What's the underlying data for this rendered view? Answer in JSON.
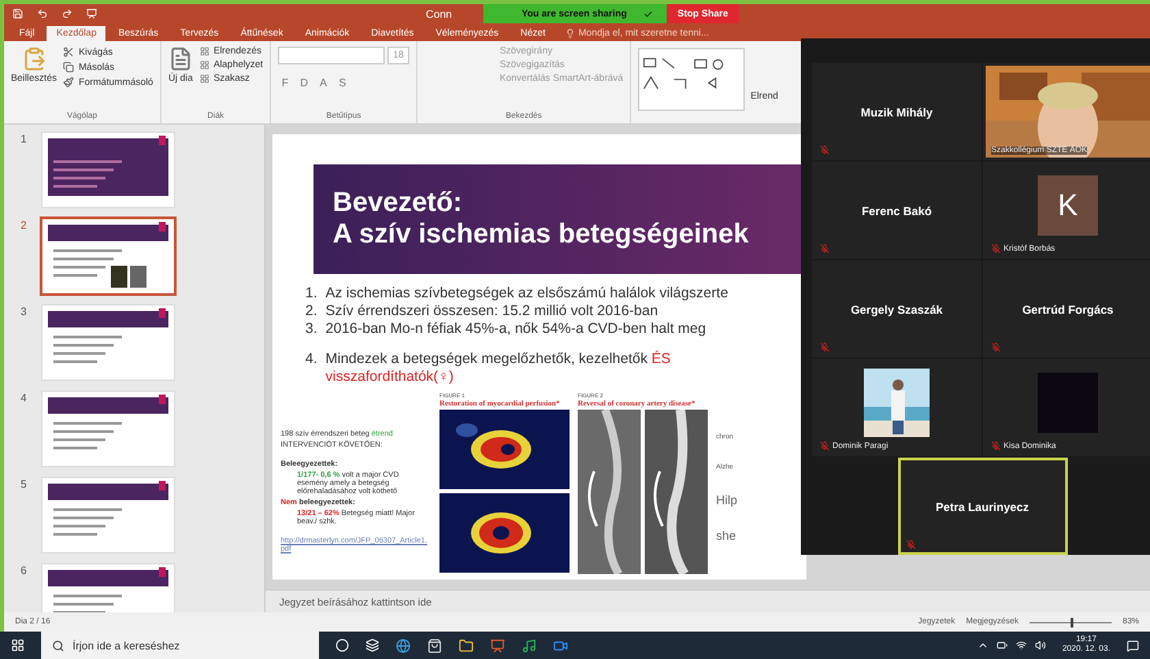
{
  "title_bar": {
    "title": "Conn"
  },
  "share_banner": {
    "status": "You are screen sharing",
    "stop": "Stop Share"
  },
  "tabs": [
    {
      "label": "Fájl",
      "selected": false
    },
    {
      "label": "Kezdőlap",
      "selected": true
    },
    {
      "label": "Beszúrás",
      "selected": false
    },
    {
      "label": "Tervezés",
      "selected": false
    },
    {
      "label": "Áttűnések",
      "selected": false
    },
    {
      "label": "Animációk",
      "selected": false
    },
    {
      "label": "Diavetítés",
      "selected": false
    },
    {
      "label": "Véleményezés",
      "selected": false
    },
    {
      "label": "Nézet",
      "selected": false
    }
  ],
  "tell_me": {
    "placeholder": "Mondja el, mit szeretne tenni..."
  },
  "ribbon": {
    "clipboard": {
      "paste": "Beillesztés",
      "items": [
        "Kivágás",
        "Másolás",
        "Formátummásoló"
      ],
      "group": "Vágólap"
    },
    "slides": {
      "new": "Új dia",
      "items": [
        "Elrendezés",
        "Alaphelyzet",
        "Szakasz"
      ],
      "group": "Diák"
    },
    "font": {
      "size": "18",
      "buttons": [
        "F",
        "D",
        "A",
        "S"
      ],
      "group": "Betűtípus"
    },
    "paragraph": {
      "items": [
        "Szövegirány",
        "Szövegigazítás",
        "Konvertálás SmartArt-ábrává"
      ],
      "group": "Bekezdés"
    },
    "drawing": {
      "label": "Elrend"
    }
  },
  "thumbnails": [
    {
      "number": "1",
      "selected": false
    },
    {
      "number": "2",
      "selected": true
    },
    {
      "number": "3",
      "selected": false
    },
    {
      "number": "4",
      "selected": false
    },
    {
      "number": "5",
      "selected": false
    },
    {
      "number": "6",
      "selected": false
    }
  ],
  "slide": {
    "title": "Bevezető:",
    "subtitle": "A szív ischemias betegségeinek",
    "points": [
      {
        "number": "1.",
        "text": "Az ischemias szívbetegségek az elsőszámú halálok világszerte"
      },
      {
        "number": "2.",
        "text": "Szív érrendszeri összesen: 15.2 millió volt 2016-ban"
      },
      {
        "number": "3.",
        "text": "2016-ban Mo-n féfiak 45%-a, nők 54%-a CVD-ben halt meg"
      },
      {
        "number": "4.",
        "text": "Mindezek a betegségek megelőzhetők, kezelhetők",
        "highlight": "ÉS visszafordíthatók(♀)"
      }
    ],
    "study": {
      "intro": "198 szív érrendszeri beteg",
      "intro_green": "étrend",
      "intro2": "INTERVENCIÓT KÖVETŐEN:",
      "groups": [
        {
          "heading": "Beleegyezettek:",
          "figure": "1/177- 0,6 %",
          "kind": "positive",
          "text": "volt a major CVD esemény amely a betegség előrehaladásához volt köthető"
        },
        {
          "heading": "beleegyezettek:",
          "heading_red": "Nem",
          "figure": "13/21 – 62%",
          "kind": "negative",
          "text": "Betegség miatt! Major beav./ szhk."
        }
      ],
      "link": "http://drmasterlyn.com/JFP_06307_Article1.pdf"
    },
    "figures": [
      {
        "label": "FIGURE 1",
        "caption": "Restoration of myocardial perfusion*",
        "kind": "scan"
      },
      {
        "label": "FIGURE 2",
        "caption": "Reversal of coronary artery disease*",
        "kind": "angio"
      }
    ],
    "side_texts": [
      "chron",
      "Alzhe",
      "Hilp",
      "she"
    ]
  },
  "notes": {
    "placeholder": "Jegyzet beírásához kattintson ide"
  },
  "gallery": [
    {
      "name": "Muzik Mihály",
      "kind": "name",
      "active": false
    },
    {
      "name": "Szakkollégium SZTE ÁOK",
      "kind": "video",
      "active": false
    },
    {
      "name": "Ferenc Bakó",
      "kind": "name",
      "active": false
    },
    {
      "name": "Kristóf Borbás",
      "kind": "avatar",
      "initial": "K",
      "active": false
    },
    {
      "name": "Gergely Szaszák",
      "kind": "name",
      "active": false
    },
    {
      "name": "Gertrúd Forgács",
      "kind": "name",
      "active": false
    },
    {
      "name": "Dominik Paragi",
      "active": false
    },
    {
      "name": "Kisa Dominika",
      "kind": "blank",
      "active": false
    },
    {
      "name": "Petra Laurinyecz",
      "kind": "name",
      "active": true
    }
  ],
  "status_bar": {
    "slide": "Dia 2 / 16",
    "notes": "Jegyzetek",
    "comments": "Megjegyzések",
    "zoom": "83%",
    "level": 0.5
  },
  "taskbar": {
    "search": {
      "placeholder": "Írjon ide a kereséshez"
    },
    "time": "19:17",
    "date": "2020. 12. 03."
  }
}
